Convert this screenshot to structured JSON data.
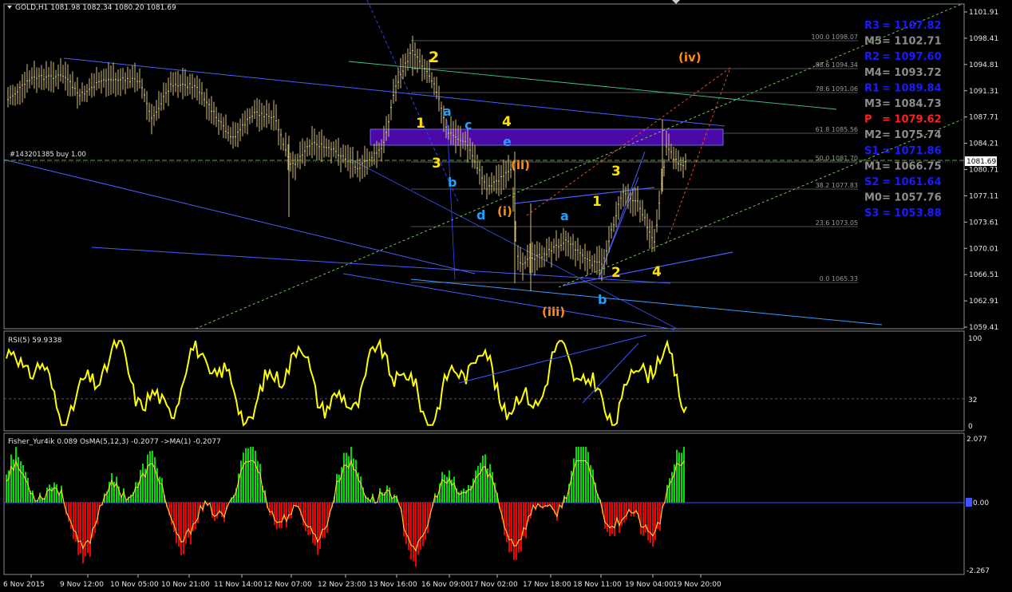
{
  "header": {
    "symbol_line": "GOLD,H1  1081.98 1082.34 1080.20 1081.69",
    "trade_line": "#143201385 buy 1.00",
    "current_price": "1081.69"
  },
  "indicators": {
    "rsi": {
      "label": "RSI(5) 59.9338",
      "scale": [
        "100",
        "32",
        "0"
      ],
      "level": 32
    },
    "fisher": {
      "label": "Fisher_Yur4ik 0.089  OsMA(5,12,3) -0.2077  ->MA(1) -0.2077",
      "scale": [
        "2.077",
        "0.00",
        "-2.267"
      ]
    }
  },
  "price_axis": [
    "1101.91",
    "1098.41",
    "1094.81",
    "1091.31",
    "1087.71",
    "1084.21",
    "1080.71",
    "1077.11",
    "1073.61",
    "1070.01",
    "1066.51",
    "1062.91",
    "1059.41"
  ],
  "time_axis": [
    "6 Nov 2015",
    "9 Nov 12:00",
    "10 Nov 05:00",
    "10 Nov 21:00",
    "11 Nov 14:00",
    "12 Nov 07:00",
    "12 Nov 23:00",
    "13 Nov 16:00",
    "16 Nov 09:00",
    "17 Nov 02:00",
    "17 Nov 18:00",
    "18 Nov 11:00",
    "19 Nov 04:00",
    "19 Nov 20:00"
  ],
  "pivots": [
    {
      "label": "R3",
      "value": "1107.82",
      "color": "#1a1aff"
    },
    {
      "label": "M5",
      "value": "1102.71",
      "color": "#8c8c8c"
    },
    {
      "label": "R2",
      "value": "1097.60",
      "color": "#1a1aff"
    },
    {
      "label": "M4",
      "value": "1093.72",
      "color": "#8c8c8c"
    },
    {
      "label": "R1",
      "value": "1089.84",
      "color": "#1a1aff"
    },
    {
      "label": "M3",
      "value": "1084.73",
      "color": "#8c8c8c"
    },
    {
      "label": "P",
      "value": "1079.62",
      "color": "#ff2020"
    },
    {
      "label": "M2",
      "value": "1075.74",
      "color": "#8c8c8c"
    },
    {
      "label": "S1",
      "value": "1071.86",
      "color": "#1a1aff"
    },
    {
      "label": "M1",
      "value": "1066.75",
      "color": "#8c8c8c"
    },
    {
      "label": "S2",
      "value": "1061.64",
      "color": "#1a1aff"
    },
    {
      "label": "M0",
      "value": "1057.76",
      "color": "#8c8c8c"
    },
    {
      "label": "S3",
      "value": "1053.88",
      "color": "#1a1aff"
    }
  ],
  "fib_levels": [
    "100.0 1098.07",
    "88.6 1094.34",
    "78.6 1091.06",
    "61.8 1085.56",
    "50.0 1081.70",
    "38.2 1077.83",
    "23.6 1073.05",
    "0.0 1065.33"
  ],
  "wave_labels": [
    {
      "text": "2",
      "color": "#ffe000"
    },
    {
      "text": "1",
      "color": "#ffe000"
    },
    {
      "text": "3",
      "color": "#ffe000"
    },
    {
      "text": "4",
      "color": "#ffe000"
    },
    {
      "text": "a",
      "color": "#1fa2ff"
    },
    {
      "text": "b",
      "color": "#1fa2ff"
    },
    {
      "text": "c",
      "color": "#1fa2ff"
    },
    {
      "text": "d",
      "color": "#1fa2ff"
    },
    {
      "text": "e",
      "color": "#1fa2ff"
    },
    {
      "text": "(ii)",
      "color": "#ff8c1a"
    },
    {
      "text": "(i)",
      "color": "#ff8c1a"
    },
    {
      "text": "(iii)",
      "color": "#ff8c1a"
    },
    {
      "text": "(iv)",
      "color": "#ff8c1a"
    },
    {
      "text": "1",
      "color": "#ffe000"
    },
    {
      "text": "3",
      "color": "#ffe000"
    },
    {
      "text": "2",
      "color": "#ffe000"
    },
    {
      "text": "4",
      "color": "#ffe000"
    },
    {
      "text": "a",
      "color": "#1fa2ff"
    },
    {
      "text": "b",
      "color": "#1fa2ff"
    }
  ],
  "chart_data": [
    {
      "type": "line",
      "title": "GOLD,H1",
      "series": [
        {
          "name": "GOLD",
          "x": [
            "6 Nov 2015",
            "9 Nov 12:00",
            "10 Nov 05:00",
            "10 Nov 21:00",
            "11 Nov 14:00",
            "12 Nov 07:00",
            "12 Nov 23:00",
            "13 Nov 16:00",
            "16 Nov 09:00",
            "17 Nov 02:00",
            "17 Nov 18:00",
            "18 Nov 11:00",
            "19 Nov 04:00",
            "19 Nov 20:00"
          ],
          "values": [
            1088.5,
            1092.8,
            1092.0,
            1091.8,
            1088.2,
            1086.9,
            1080.5,
            1091.0,
            1089.0,
            1078.0,
            1068.0,
            1071.0,
            1076.0,
            1081.7
          ]
        }
      ],
      "ylim": [
        1059.41,
        1101.91
      ],
      "grid": false
    },
    {
      "type": "line",
      "title": "RSI(5) 59.9338",
      "ylim": [
        0,
        100
      ],
      "level": 32
    },
    {
      "type": "bar",
      "title": "Fisher_Yur4ik 0.089  OsMA(5,12,3) -0.2077  ->MA(1) -0.2077",
      "ylim": [
        -2.267,
        2.077
      ]
    }
  ],
  "colors": {
    "rsi": "#ffff00",
    "fisher_pos": "#00dd00",
    "fisher_neg": "#ee0000",
    "zone": "#4b0aa8",
    "trend": "#3a55ff"
  }
}
